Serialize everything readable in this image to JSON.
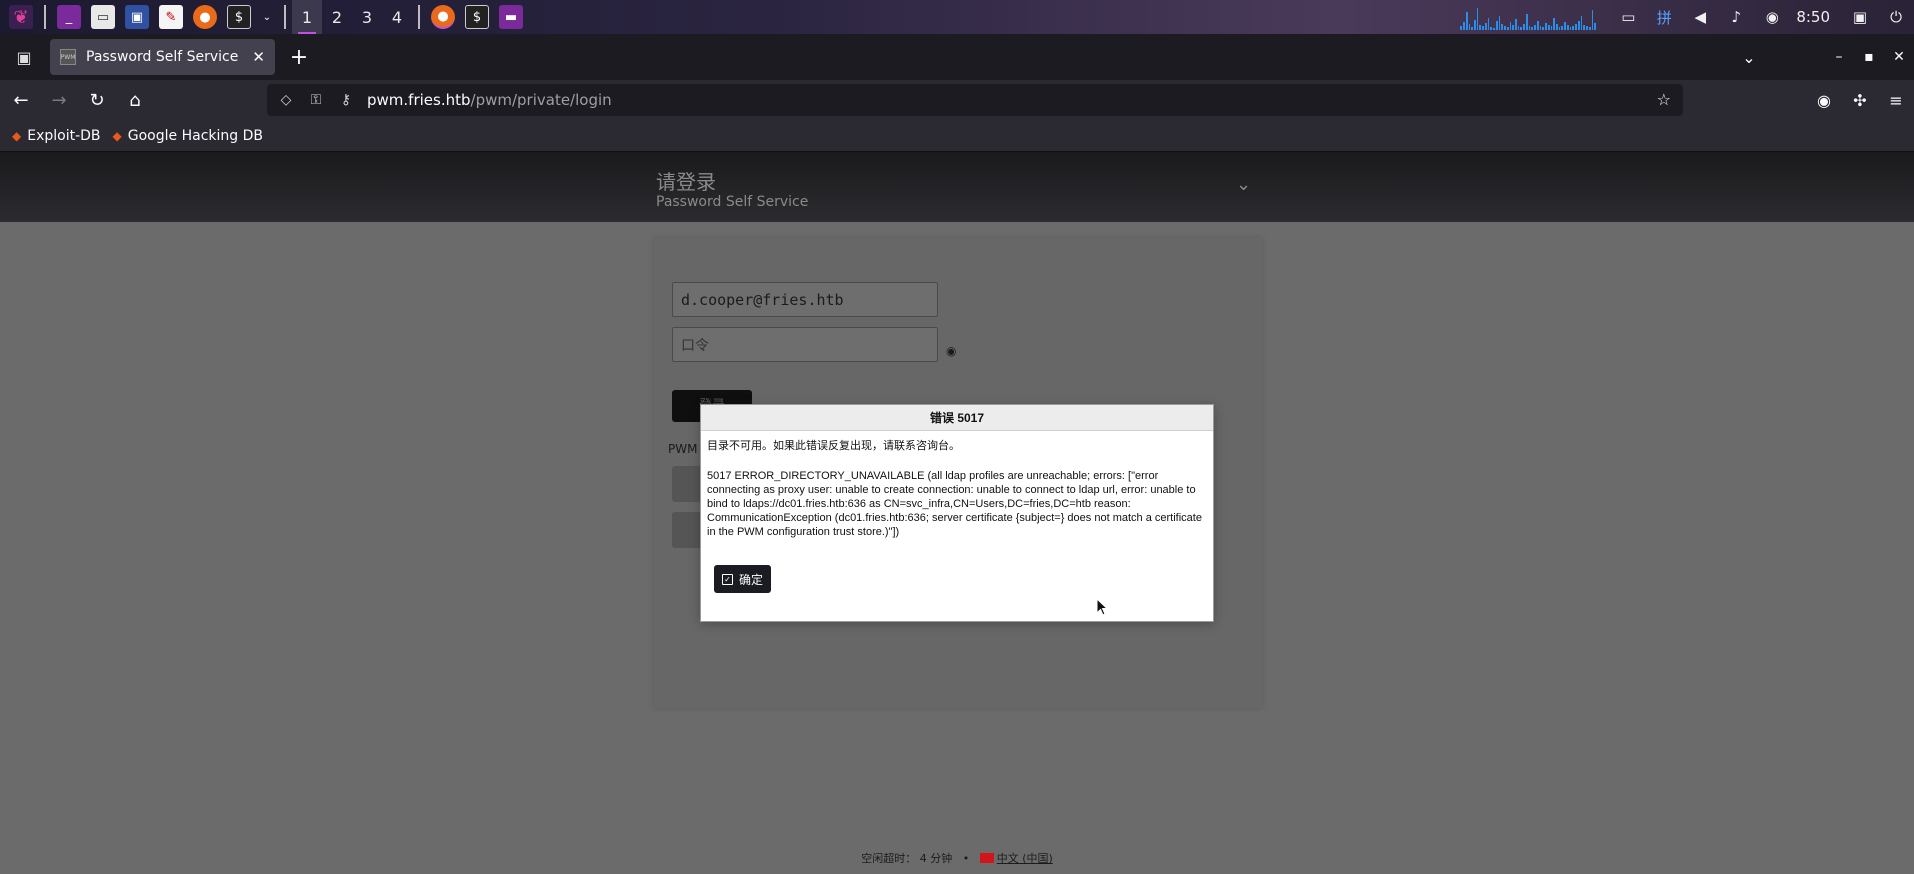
{
  "taskbar": {
    "workspaces": [
      "1",
      "2",
      "3",
      "4"
    ],
    "clock": "8:50"
  },
  "browser": {
    "tab_title": "Password Self Service",
    "tab_favicon": "PWM",
    "url_host": "pwm.fries.htb",
    "url_path": "/pwm/private/login",
    "bookmarks": [
      "Exploit-DB",
      "Google Hacking DB"
    ]
  },
  "page": {
    "header_title": "请登录",
    "header_subtitle": "Password Self Service",
    "username_value": "d.cooper@fries.htb",
    "password_placeholder": "口令",
    "login_button": "登录",
    "pwm_label": "PWM",
    "footer_idle": "空闲超时： 4 分钟",
    "footer_sep": "•",
    "footer_language": "中文 (中国)"
  },
  "dialog": {
    "title": "错误 5017",
    "message": "目录不可用。如果此错误反复出现，请联系咨询台。",
    "detail": "5017 ERROR_DIRECTORY_UNAVAILABLE (all ldap profiles are unreachable; errors: [\"error connecting as proxy user: unable to create connection: unable to connect to ldap url, error: unable to bind to ldaps://dc01.fries.htb:636 as CN=svc_infra,CN=Users,DC=fries,DC=htb reason: CommunicationException (dc01.fries.htb:636; server certificate {subject=} does not match a certificate in the PWM configuration trust store.)\"])",
    "ok_button": "确定"
  },
  "colors": {
    "dialog_button": "#1b1b22",
    "page_background": "#6b6b6b",
    "taskbar_accent": "#c050e0",
    "cpu_graph": "#2a8ee8"
  }
}
